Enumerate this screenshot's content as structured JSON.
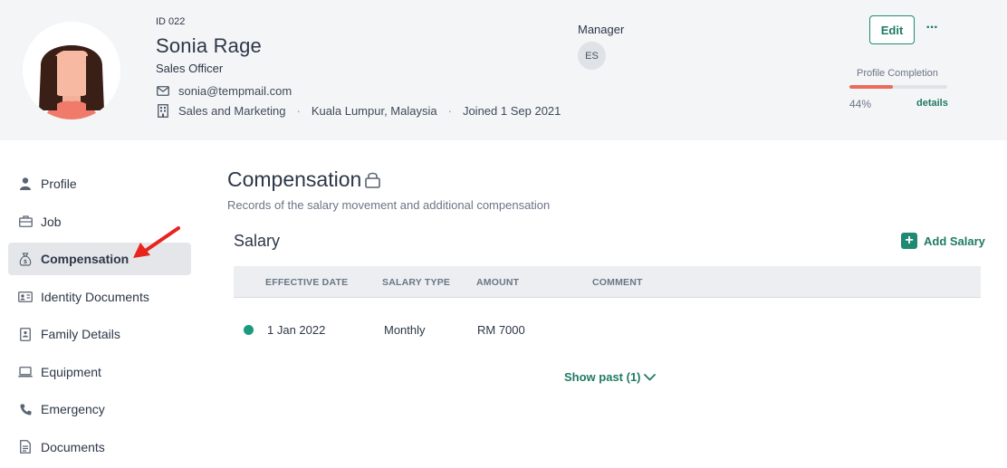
{
  "employee": {
    "id_label": "ID 022",
    "name": "Sonia Rage",
    "title": "Sales Officer",
    "email": "sonia@tempmail.com",
    "department": "Sales and Marketing",
    "location": "Kuala Lumpur, Malaysia",
    "joined": "Joined 1 Sep 2021",
    "separator": "·"
  },
  "manager": {
    "label": "Manager",
    "initials": "ES"
  },
  "actions": {
    "edit_label": "Edit",
    "more_label": "···"
  },
  "profile_completion": {
    "label": "Profile Completion",
    "percent_text": "44%",
    "percent_value": 0.44,
    "details_label": "details",
    "bar_color": "#ec6b5b"
  },
  "sidebar": {
    "items": [
      {
        "label": "Profile",
        "icon": "person-icon"
      },
      {
        "label": "Job",
        "icon": "briefcase-icon"
      },
      {
        "label": "Compensation",
        "icon": "money-bag-icon",
        "active": true
      },
      {
        "label": "Identity Documents",
        "icon": "id-card-icon"
      },
      {
        "label": "Family Details",
        "icon": "family-document-icon"
      },
      {
        "label": "Equipment",
        "icon": "laptop-icon"
      },
      {
        "label": "Emergency",
        "icon": "phone-icon"
      },
      {
        "label": "Documents",
        "icon": "document-icon"
      }
    ]
  },
  "main": {
    "title": "Compensation",
    "subtitle": "Records of the salary movement and additional compensation",
    "salary": {
      "section_title": "Salary",
      "add_label": "Add Salary",
      "columns": [
        "EFFECTIVE DATE",
        "SALARY TYPE",
        "AMOUNT",
        "COMMENT"
      ],
      "rows": [
        {
          "status_color": "#1a9a7f",
          "effective_date": "1 Jan 2022",
          "salary_type": "Monthly",
          "amount": "RM 7000",
          "comment": ""
        }
      ],
      "show_past_label": "Show past (1)"
    }
  },
  "colors": {
    "accent": "#1f7a64",
    "header_bg": "#f4f5f7",
    "annotation_arrow": "#e8241c"
  }
}
